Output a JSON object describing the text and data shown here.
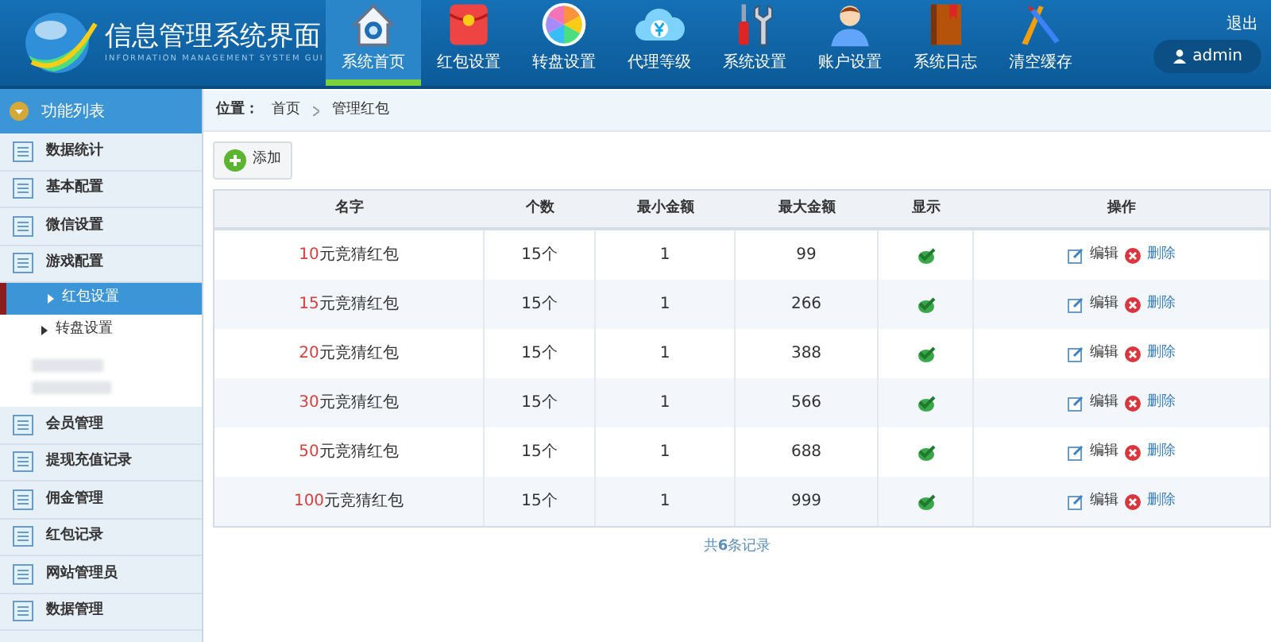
{
  "header": {
    "title": "信息管理系统界面",
    "subtitle": "INFORMATION MANAGEMENT SYSTEM GUI",
    "nav": [
      {
        "label": "系统首页",
        "selected": true
      },
      {
        "label": "红包设置",
        "selected": false
      },
      {
        "label": "转盘设置",
        "selected": false
      },
      {
        "label": "代理等级",
        "selected": false
      },
      {
        "label": "系统设置",
        "selected": false
      },
      {
        "label": "账户设置",
        "selected": false
      },
      {
        "label": "系统日志",
        "selected": false
      },
      {
        "label": "清空缓存",
        "selected": false
      }
    ],
    "logout": "退出",
    "user": "admin"
  },
  "sidebar": {
    "title": "功能列表",
    "items": [
      {
        "label": "数据统计"
      },
      {
        "label": "基本配置"
      },
      {
        "label": "微信设置"
      },
      {
        "label": "游戏配置",
        "children": [
          {
            "label": "红包设置",
            "selected": true
          },
          {
            "label": "转盘设置",
            "selected": false
          }
        ]
      },
      {
        "label": "会员管理"
      },
      {
        "label": "提现充值记录"
      },
      {
        "label": "佣金管理"
      },
      {
        "label": "红包记录"
      },
      {
        "label": "网站管理员"
      },
      {
        "label": "数据管理"
      }
    ]
  },
  "breadcrumb": {
    "label": "位置：",
    "items": [
      "首页",
      "管理红包"
    ]
  },
  "add_button": "添加",
  "table": {
    "columns": [
      "名字",
      "个数",
      "最小金额",
      "最大金额",
      "显示",
      "操作"
    ],
    "rows": [
      {
        "amount": "10",
        "name": "元竞猜红包",
        "count": "15个",
        "min": "1",
        "max": "99",
        "shown": true,
        "edit": "编辑",
        "delete": "删除"
      },
      {
        "amount": "15",
        "name": "元竞猜红包",
        "count": "15个",
        "min": "1",
        "max": "266",
        "shown": true,
        "edit": "编辑",
        "delete": "删除"
      },
      {
        "amount": "20",
        "name": "元竞猜红包",
        "count": "15个",
        "min": "1",
        "max": "388",
        "shown": true,
        "edit": "编辑",
        "delete": "删除"
      },
      {
        "amount": "30",
        "name": "元竞猜红包",
        "count": "15个",
        "min": "1",
        "max": "566",
        "shown": true,
        "edit": "编辑",
        "delete": "删除"
      },
      {
        "amount": "50",
        "name": "元竞猜红包",
        "count": "15个",
        "min": "1",
        "max": "688",
        "shown": true,
        "edit": "编辑",
        "delete": "删除"
      },
      {
        "amount": "100",
        "name": "元竞猜红包",
        "count": "15个",
        "min": "1",
        "max": "999",
        "shown": true,
        "edit": "编辑",
        "delete": "删除"
      }
    ],
    "footer": "共**6**条记录"
  }
}
